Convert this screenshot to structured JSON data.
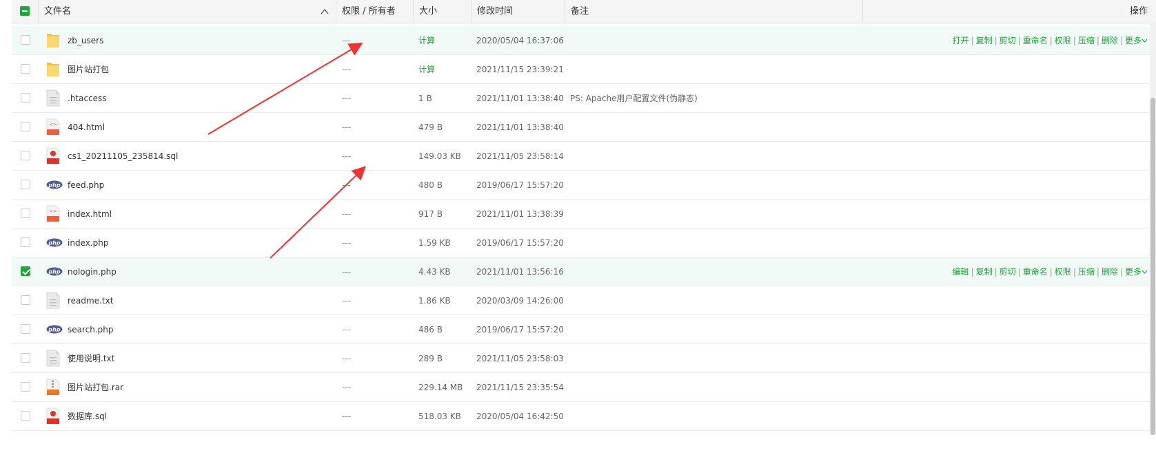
{
  "header": {
    "name": "文件名",
    "perm": "权限 / 所有者",
    "size": "大小",
    "mtime": "修改时间",
    "note": "备注",
    "ops": "操作",
    "sort_icon": "chevron-up-icon"
  },
  "colors": {
    "accent": "#20a53a",
    "arrow": "#ee3333",
    "row_highlight": "#f2faf7"
  },
  "files": [
    {
      "name": "zb_users",
      "type": "folder",
      "perm": "---",
      "size": "计算",
      "mtime": "2020/05/04 16:37:06",
      "note": "",
      "highlight": true,
      "checked": false,
      "ops": [
        "打开",
        "复制",
        "剪切",
        "重命名",
        "权限",
        "压缩",
        "删除",
        "更多"
      ]
    },
    {
      "name": "图片站打包",
      "type": "folder",
      "perm": "---",
      "size": "计算",
      "mtime": "2021/11/15 23:39:21",
      "note": "",
      "highlight": false,
      "checked": false,
      "ops": []
    },
    {
      "name": ".htaccess",
      "type": "text",
      "perm": "---",
      "size": "1 B",
      "mtime": "2021/11/01 13:38:40",
      "note": "PS: Apache用户配置文件(伪静态)",
      "highlight": false,
      "checked": false,
      "ops": []
    },
    {
      "name": "404.html",
      "type": "html",
      "perm": "---",
      "size": "479 B",
      "mtime": "2021/11/01 13:38:40",
      "note": "",
      "highlight": false,
      "checked": false,
      "ops": []
    },
    {
      "name": "cs1_20211105_235814.sql",
      "type": "sql",
      "perm": "---",
      "size": "149.03 KB",
      "mtime": "2021/11/05 23:58:14",
      "note": "",
      "highlight": false,
      "checked": false,
      "ops": []
    },
    {
      "name": "feed.php",
      "type": "php",
      "perm": "---",
      "size": "480 B",
      "mtime": "2019/06/17 15:57:20",
      "note": "",
      "highlight": false,
      "checked": false,
      "ops": []
    },
    {
      "name": "index.html",
      "type": "html",
      "perm": "---",
      "size": "917 B",
      "mtime": "2021/11/01 13:38:39",
      "note": "",
      "highlight": false,
      "checked": false,
      "ops": []
    },
    {
      "name": "index.php",
      "type": "php",
      "perm": "---",
      "size": "1.59 KB",
      "mtime": "2019/06/17 15:57:20",
      "note": "",
      "highlight": false,
      "checked": false,
      "ops": []
    },
    {
      "name": "nologin.php",
      "type": "php",
      "perm": "---",
      "size": "4.43 KB",
      "mtime": "2021/11/01 13:56:16",
      "note": "",
      "highlight": true,
      "checked": true,
      "ops": [
        "编辑",
        "复制",
        "剪切",
        "重命名",
        "权限",
        "压缩",
        "删除",
        "更多"
      ]
    },
    {
      "name": "readme.txt",
      "type": "text",
      "perm": "---",
      "size": "1.86 KB",
      "mtime": "2020/03/09 14:26:00",
      "note": "",
      "highlight": false,
      "checked": false,
      "ops": []
    },
    {
      "name": "search.php",
      "type": "php",
      "perm": "---",
      "size": "486 B",
      "mtime": "2019/06/17 15:57:20",
      "note": "",
      "highlight": false,
      "checked": false,
      "ops": []
    },
    {
      "name": "使用说明.txt",
      "type": "text",
      "perm": "---",
      "size": "289 B",
      "mtime": "2021/11/05 23:58:03",
      "note": "",
      "highlight": false,
      "checked": false,
      "ops": []
    },
    {
      "name": "图片站打包.rar",
      "type": "rar",
      "perm": "---",
      "size": "229.14 MB",
      "mtime": "2021/11/15 23:35:54",
      "note": "",
      "highlight": false,
      "checked": false,
      "ops": []
    },
    {
      "name": "数据库.sql",
      "type": "sql",
      "perm": "---",
      "size": "518.03 KB",
      "mtime": "2020/05/04 16:42:50",
      "note": "",
      "highlight": false,
      "checked": false,
      "ops": []
    }
  ]
}
